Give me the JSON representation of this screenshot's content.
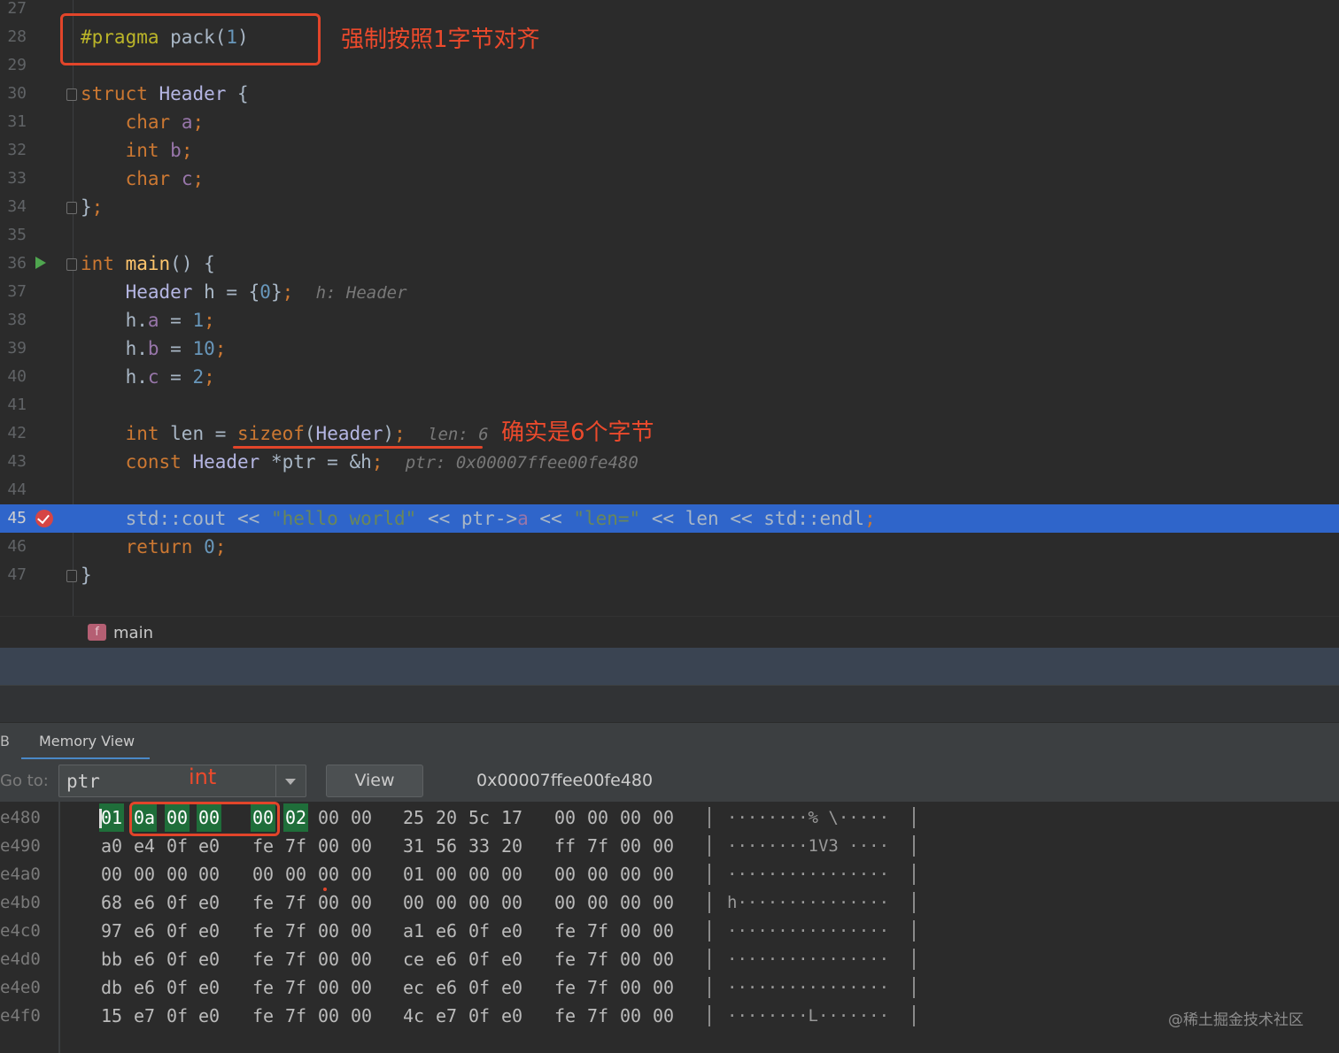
{
  "editor": {
    "lines": [
      {
        "num": "27",
        "tokens": []
      },
      {
        "num": "28",
        "tokens": [
          [
            "macro",
            "#pragma"
          ],
          [
            "",
            " pack("
          ],
          [
            "num",
            "1"
          ],
          [
            "",
            ")"
          ]
        ]
      },
      {
        "num": "29",
        "tokens": []
      },
      {
        "num": "30",
        "tokens": [
          [
            "kw",
            "struct"
          ],
          [
            "",
            " "
          ],
          [
            "ty",
            "Header"
          ],
          [
            "",
            " {"
          ]
        ]
      },
      {
        "num": "31",
        "tokens": [
          [
            "",
            "    "
          ],
          [
            "kw",
            "char"
          ],
          [
            "",
            " "
          ],
          [
            "mem",
            "a"
          ],
          [
            "kw",
            ";"
          ]
        ]
      },
      {
        "num": "32",
        "tokens": [
          [
            "",
            "    "
          ],
          [
            "kw",
            "int"
          ],
          [
            "",
            " "
          ],
          [
            "mem",
            "b"
          ],
          [
            "kw",
            ";"
          ]
        ]
      },
      {
        "num": "33",
        "tokens": [
          [
            "",
            "    "
          ],
          [
            "kw",
            "char"
          ],
          [
            "",
            " "
          ],
          [
            "mem",
            "c"
          ],
          [
            "kw",
            ";"
          ]
        ]
      },
      {
        "num": "34",
        "tokens": [
          [
            "",
            "}"
          ],
          [
            "kw",
            ";"
          ]
        ]
      },
      {
        "num": "35",
        "tokens": []
      },
      {
        "num": "36",
        "tokens": [
          [
            "kw",
            "int"
          ],
          [
            "",
            " "
          ],
          [
            "fn",
            "main"
          ],
          [
            "",
            "() {"
          ]
        ]
      },
      {
        "num": "37",
        "tokens": [
          [
            "",
            "    "
          ],
          [
            "ty",
            "Header"
          ],
          [
            "",
            " h = {"
          ],
          [
            "num",
            "0"
          ],
          [
            "",
            "}"
          ],
          [
            "kw",
            ";"
          ],
          [
            "",
            "  "
          ],
          [
            "hint",
            "h: Header"
          ]
        ]
      },
      {
        "num": "38",
        "tokens": [
          [
            "",
            "    h."
          ],
          [
            "mem",
            "a"
          ],
          [
            "",
            " = "
          ],
          [
            "num",
            "1"
          ],
          [
            "kw",
            ";"
          ]
        ]
      },
      {
        "num": "39",
        "tokens": [
          [
            "",
            "    h."
          ],
          [
            "mem",
            "b"
          ],
          [
            "",
            " = "
          ],
          [
            "num",
            "10"
          ],
          [
            "kw",
            ";"
          ]
        ]
      },
      {
        "num": "40",
        "tokens": [
          [
            "",
            "    h."
          ],
          [
            "mem",
            "c"
          ],
          [
            "",
            " = "
          ],
          [
            "num",
            "2"
          ],
          [
            "kw",
            ";"
          ]
        ]
      },
      {
        "num": "41",
        "tokens": []
      },
      {
        "num": "42",
        "tokens": [
          [
            "",
            "    "
          ],
          [
            "kw",
            "int"
          ],
          [
            "",
            " len = "
          ],
          [
            "kw",
            "sizeof"
          ],
          [
            "",
            "("
          ],
          [
            "ty",
            "Header"
          ],
          [
            "",
            ")"
          ],
          [
            "kw",
            ";"
          ],
          [
            "",
            "  "
          ],
          [
            "hint",
            "len: 6"
          ]
        ]
      },
      {
        "num": "43",
        "tokens": [
          [
            "",
            "    "
          ],
          [
            "kw",
            "const"
          ],
          [
            "",
            " "
          ],
          [
            "ty",
            "Header"
          ],
          [
            "",
            " *ptr = &h"
          ],
          [
            "kw",
            ";"
          ],
          [
            "",
            "  "
          ],
          [
            "hint",
            "ptr: 0x00007ffee00fe480"
          ]
        ]
      },
      {
        "num": "44",
        "tokens": []
      },
      {
        "num": "45",
        "tokens": [
          [
            "",
            "    std::cout << "
          ],
          [
            "str",
            "\"hello world\""
          ],
          [
            "",
            " << ptr->"
          ],
          [
            "mem",
            "a"
          ],
          [
            "",
            " << "
          ],
          [
            "str",
            "\"len=\""
          ],
          [
            "",
            " << len << std::endl"
          ],
          [
            "kw",
            ";"
          ]
        ]
      },
      {
        "num": "46",
        "tokens": [
          [
            "",
            "    "
          ],
          [
            "kw",
            "return"
          ],
          [
            "",
            " "
          ],
          [
            "num",
            "0"
          ],
          [
            "kw",
            ";"
          ]
        ]
      },
      {
        "num": "47",
        "tokens": [
          [
            "",
            "}"
          ]
        ]
      }
    ],
    "annotations": {
      "pragma_note": "强制按照1字节对齐",
      "sizeof_note": "确实是6个字节"
    }
  },
  "breadcrumb": {
    "icon_letter": "f",
    "label": "main"
  },
  "tabs": {
    "prev_tab_label": "B",
    "active_tab_label": "Memory View"
  },
  "toolbar": {
    "goto_label": "Go to:",
    "goto_value": "ptr",
    "type_annotation": "int",
    "view_button": "View",
    "address": "0x00007ffee00fe480"
  },
  "memory": {
    "rows": [
      {
        "addr": "e480",
        "bytes": [
          "01",
          "0a",
          "00",
          "00",
          "00",
          "02",
          "00",
          "00",
          "25",
          "20",
          "5c",
          "17",
          "00",
          "00",
          "00",
          "00"
        ],
        "ascii": "········% \\·····"
      },
      {
        "addr": "e490",
        "bytes": [
          "a0",
          "e4",
          "0f",
          "e0",
          "fe",
          "7f",
          "00",
          "00",
          "31",
          "56",
          "33",
          "20",
          "ff",
          "7f",
          "00",
          "00"
        ],
        "ascii": "········1V3 ····"
      },
      {
        "addr": "e4a0",
        "bytes": [
          "00",
          "00",
          "00",
          "00",
          "00",
          "00",
          "00",
          "00",
          "01",
          "00",
          "00",
          "00",
          "00",
          "00",
          "00",
          "00"
        ],
        "ascii": "················"
      },
      {
        "addr": "e4b0",
        "bytes": [
          "68",
          "e6",
          "0f",
          "e0",
          "fe",
          "7f",
          "00",
          "00",
          "00",
          "00",
          "00",
          "00",
          "00",
          "00",
          "00",
          "00"
        ],
        "ascii": "h···············"
      },
      {
        "addr": "e4c0",
        "bytes": [
          "97",
          "e6",
          "0f",
          "e0",
          "fe",
          "7f",
          "00",
          "00",
          "a1",
          "e6",
          "0f",
          "e0",
          "fe",
          "7f",
          "00",
          "00"
        ],
        "ascii": "················"
      },
      {
        "addr": "e4d0",
        "bytes": [
          "bb",
          "e6",
          "0f",
          "e0",
          "fe",
          "7f",
          "00",
          "00",
          "ce",
          "e6",
          "0f",
          "e0",
          "fe",
          "7f",
          "00",
          "00"
        ],
        "ascii": "················"
      },
      {
        "addr": "e4e0",
        "bytes": [
          "db",
          "e6",
          "0f",
          "e0",
          "fe",
          "7f",
          "00",
          "00",
          "ec",
          "e6",
          "0f",
          "e0",
          "fe",
          "7f",
          "00",
          "00"
        ],
        "ascii": "················"
      },
      {
        "addr": "e4f0",
        "bytes": [
          "15",
          "e7",
          "0f",
          "e0",
          "fe",
          "7f",
          "00",
          "00",
          "4c",
          "e7",
          "0f",
          "e0",
          "fe",
          "7f",
          "00",
          "00"
        ],
        "ascii": "········L·······"
      }
    ],
    "highlighted_bytes": 6
  },
  "watermark": "@稀土掘金技术社区",
  "colors": {
    "accent_red": "#e2452a",
    "exec_line": "#2f65ca",
    "byte_highlight": "#1f6e3a"
  }
}
